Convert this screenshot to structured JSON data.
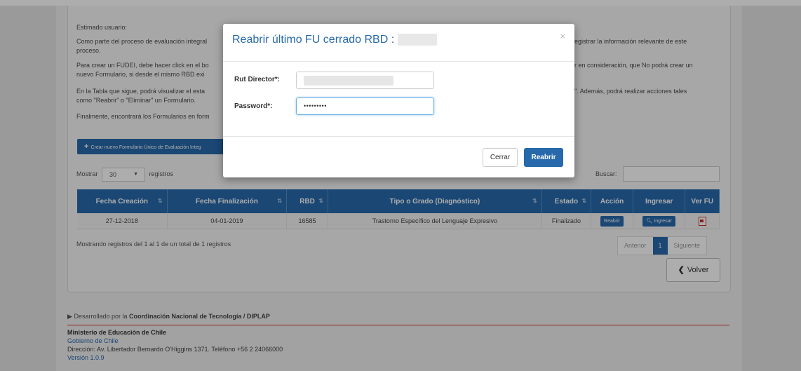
{
  "intro": {
    "greeting": "Estimado usuario:",
    "p1a": "Como parte del proceso de evaluación integral",
    "p1b": "egistrar la información relevante de este",
    "p1c": "proceso.",
    "p2a": "Para crear un FUDEI, debe hacer click en el bo",
    "p2b": "r en consideración, que No podrá crear un",
    "p2c": "nuevo Formulario, si desde el mismo RBD exi",
    "p3a": "En la Tabla que sigue, podrá visualizar el esta",
    "p3b": "\". Además, podrá realizar acciones tales",
    "p3c": "como \"Reabrir\" o \"Eliminar\" un Formulario.",
    "p4": "Finalmente, encontrará los Formularios en form"
  },
  "toolbar": {
    "create_label": "Crear nuevo Formulario Único de Evaluación Integ",
    "show_label": "Mostrar",
    "show_value": "30",
    "records_label": "registros",
    "search_label": "Buscar:"
  },
  "table": {
    "headers": [
      "Fecha Creación",
      "Fecha Finalización",
      "RBD",
      "Tipo o Grado (Diagnóstico)",
      "Estado",
      "Acción",
      "Ingresar",
      "Ver FU"
    ],
    "row": {
      "fecha_creacion": "27-12-2018",
      "fecha_finalizacion": "04-01-2019",
      "rbd": "16585",
      "tipo": "Trastorno Específico del Lenguaje Expresivo",
      "estado": "Finalizado",
      "accion": "Reabrir",
      "ingresar": "Ingresar"
    }
  },
  "pagination": {
    "info": "Mostrando registros del 1 al 1 de un total de 1 registros",
    "prev": "Anterior",
    "current": "1",
    "next": "Siguiente"
  },
  "back_label": "Volver",
  "footer": {
    "dev_prefix": "Desarrollado por la",
    "dev_org": "Coordinación Nacional de Tecnología / DIPLAP",
    "ministry": "Ministerio de Educación de Chile",
    "gobierno": "Gobierno de Chile",
    "address": "Dirección: Av. Libertador Bernardo O'Higgins 1371. Teléfono +56 2 24066000",
    "version": "Versión 1.0.9"
  },
  "modal": {
    "title": "Reabrir último FU cerrado RBD :",
    "close_symbol": "×",
    "rut_label": "Rut Director*:",
    "password_label": "Password*:",
    "password_mask": "•••••••••",
    "cancel_label": "Cerrar",
    "confirm_label": "Reabrir"
  },
  "colors": {
    "primary": "#2769ab",
    "footer_rule": "#c9302c"
  }
}
